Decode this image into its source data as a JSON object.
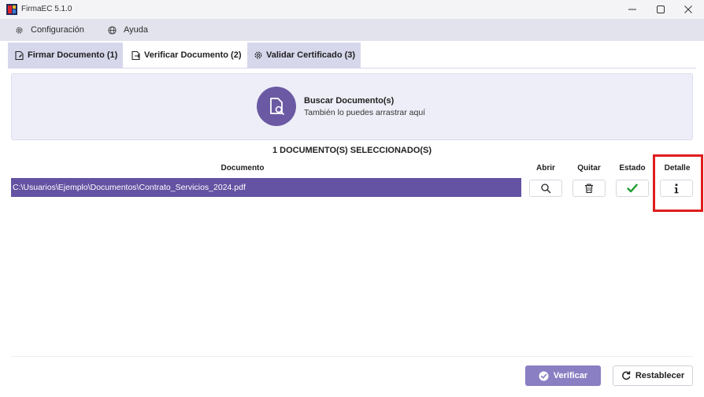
{
  "window": {
    "title": "FirmaEC 5.1.0",
    "colors": {
      "accent": "#6452a2",
      "tab_inactive": "#d7d7ec",
      "highlight": "#e01d1d"
    }
  },
  "menu": {
    "items": [
      {
        "label": "Configuración",
        "icon": "gear-icon"
      },
      {
        "label": "Ayuda",
        "icon": "globe-icon"
      }
    ]
  },
  "tabs": [
    {
      "label": "Firmar Documento (1)",
      "icon": "sign-document-icon",
      "active": false
    },
    {
      "label": "Verificar Documento (2)",
      "icon": "verify-document-icon",
      "active": true
    },
    {
      "label": "Validar Certificado (3)",
      "icon": "gear-icon",
      "active": false
    }
  ],
  "dropzone": {
    "title": "Buscar Documento(s)",
    "subtitle": "También lo puedes arrastrar aquí",
    "icon": "search-document-icon"
  },
  "selection": {
    "count_label": "1 DOCUMENTO(S) SELECCIONADO(S)"
  },
  "table": {
    "columns": {
      "documento": "Documento",
      "abrir": "Abrir",
      "quitar": "Quitar",
      "estado": "Estado",
      "detalle": "Detalle"
    },
    "rows": [
      {
        "path": "C:\\Usuarios\\Ejemplo\\Documentos\\Contrato_Servicios_2024.pdf",
        "abrir_icon": "magnifier-icon",
        "quitar_icon": "trash-icon",
        "estado_icon": "check-icon",
        "detalle_icon": "info-icon"
      }
    ]
  },
  "footer": {
    "verify_label": "Verificar",
    "reset_label": "Restablecer"
  }
}
